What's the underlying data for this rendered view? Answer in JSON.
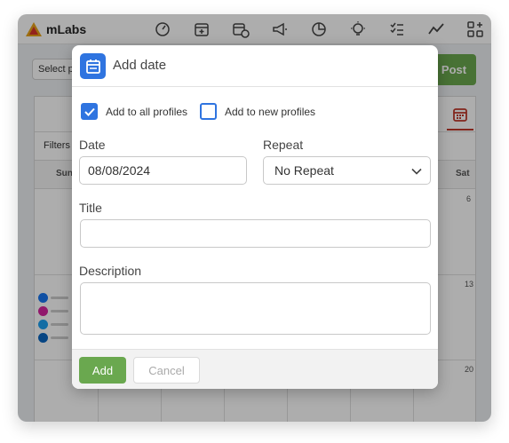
{
  "app": {
    "logo_text": "mLabs",
    "nav_icons": [
      "dashboard-icon",
      "calendar-add-icon",
      "calendar-clock-icon",
      "megaphone-icon",
      "pie-chart-icon",
      "lightbulb-icon",
      "checklist-icon",
      "trend-icon",
      "grid-add-icon"
    ],
    "select_profiles_placeholder": "Select p",
    "post_button_label": "Post",
    "filters_label": "Filters",
    "day_headers": {
      "sun": "Sun",
      "sat": "Sat"
    },
    "day_numbers": {
      "first": "6",
      "second": "13",
      "third": "20"
    },
    "social_icons": [
      "facebook-icon",
      "instagram-icon",
      "twitter-icon",
      "linkedin-icon"
    ],
    "colors": {
      "accent_blue": "#2f74e0",
      "accent_green": "#6aa84f",
      "calendar_red": "#c0392b"
    }
  },
  "modal": {
    "title": "Add date",
    "add_to_all_profiles": {
      "label": "Add to all profiles",
      "checked": true
    },
    "add_to_new_profiles": {
      "label": "Add to new profiles",
      "checked": false
    },
    "date": {
      "label": "Date",
      "value": "08/08/2024"
    },
    "repeat": {
      "label": "Repeat",
      "value": "No Repeat"
    },
    "title_field": {
      "label": "Title",
      "value": ""
    },
    "description": {
      "label": "Description",
      "value": ""
    },
    "add_button_label": "Add",
    "cancel_button_label": "Cancel"
  }
}
